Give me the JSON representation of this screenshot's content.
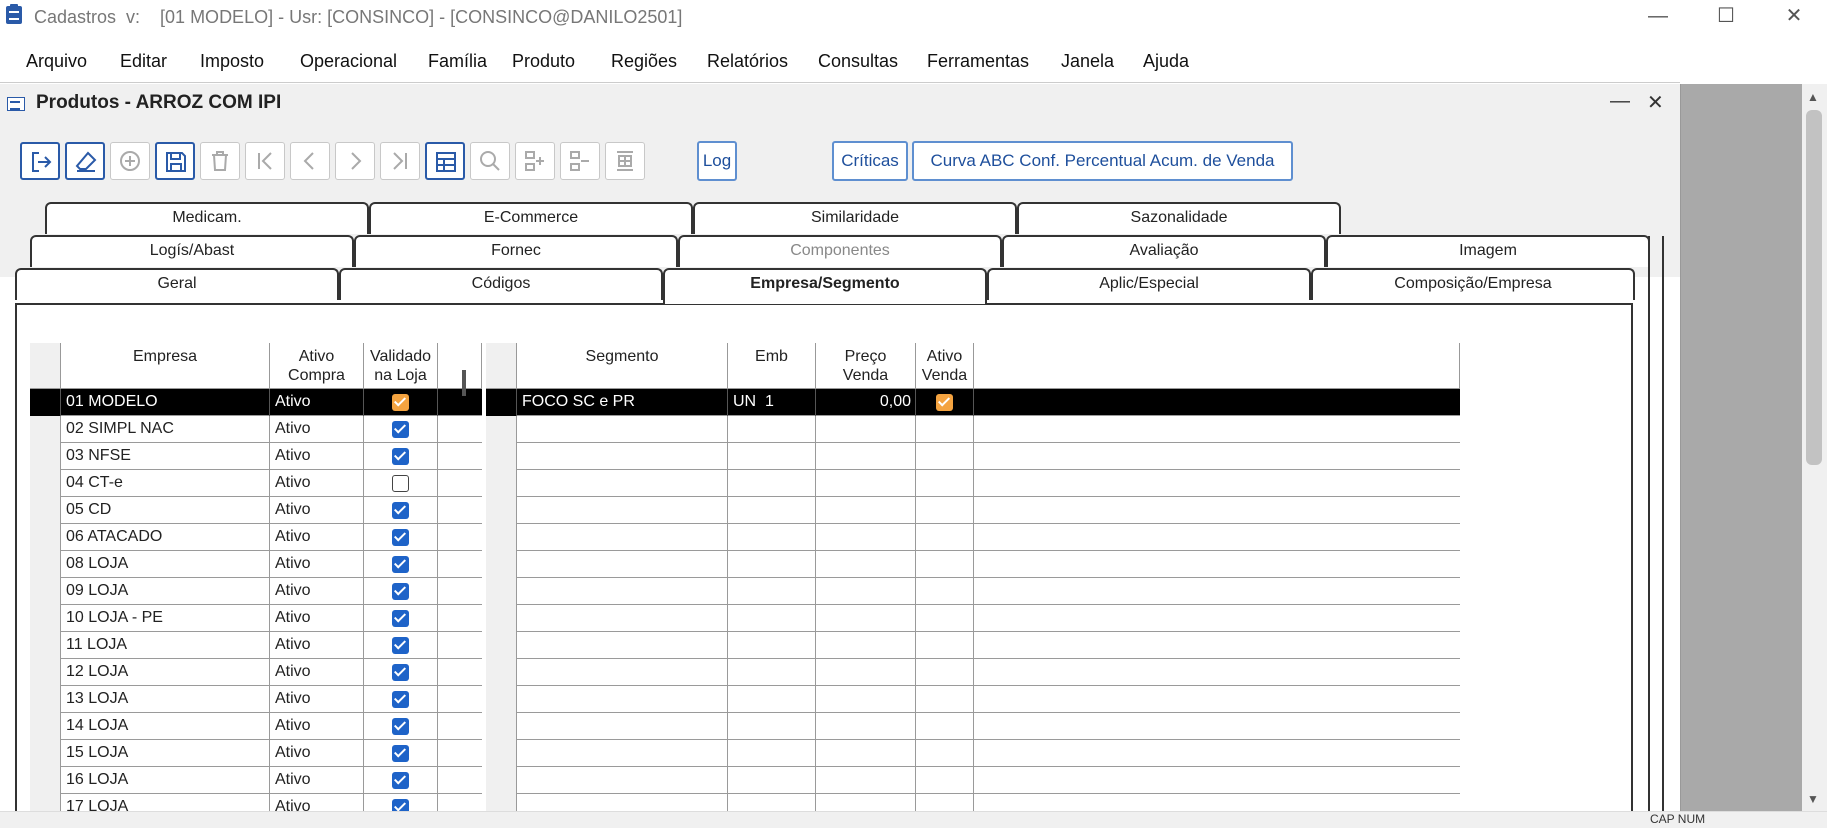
{
  "window": {
    "title": "Cadastros  v:    [01 MODELO] - Usr: [CONSINCO] - [CONSINCO@DANILO2501]",
    "minimize": "—",
    "maximize": "☐",
    "close": "✕"
  },
  "menu": [
    "Arquivo",
    "Editar",
    "Imposto",
    "Operacional",
    "Família",
    "Produto",
    "Regiões",
    "Relatórios",
    "Consultas",
    "Ferramentas",
    "Janela",
    "Ajuda"
  ],
  "inner": {
    "title": "Produtos - ARROZ COM IPI",
    "minimize": "—",
    "close": "✕"
  },
  "toolbar": {
    "icons": [
      "exit-icon",
      "eraser-icon",
      "add-icon",
      "save-icon",
      "delete-icon",
      "first-icon",
      "previous-icon",
      "next-icon",
      "last-icon",
      "grid-icon",
      "search-icon",
      "insert-row-icon",
      "remove-row-icon",
      "split-icon"
    ],
    "log_label": "Log",
    "criticas_label": "Críticas",
    "curva_label": "Curva ABC Conf. Percentual Acum. de Venda"
  },
  "tabs": {
    "row1": [
      "Medicam.",
      "E-Commerce",
      "Similaridade",
      "Sazonalidade"
    ],
    "row2": [
      "Logís/Abast",
      "Fornec",
      "Componentes",
      "Avaliação",
      "Imagem"
    ],
    "row3": [
      "Geral",
      "Códigos",
      "Empresa/Segmento",
      "Aplic/Especial",
      "Composição/Empresa"
    ],
    "selected": "Empresa/Segmento"
  },
  "empresa_grid": {
    "headers": [
      "Empresa",
      "Ativo Compra",
      "Validado na Loja"
    ],
    "header_lines": [
      [
        "Empresa"
      ],
      [
        "Ativo",
        "Compra"
      ],
      [
        "Validado",
        "na Loja"
      ]
    ],
    "rows": [
      {
        "empresa": "01 MODELO",
        "ativo": "Ativo",
        "validado": "selected"
      },
      {
        "empresa": "02 SIMPL NAC",
        "ativo": "Ativo",
        "validado": "on"
      },
      {
        "empresa": "03 NFSE",
        "ativo": "Ativo",
        "validado": "on"
      },
      {
        "empresa": "04 CT-e",
        "ativo": "Ativo",
        "validado": "off"
      },
      {
        "empresa": "05 CD",
        "ativo": "Ativo",
        "validado": "on"
      },
      {
        "empresa": "06 ATACADO",
        "ativo": "Ativo",
        "validado": "on"
      },
      {
        "empresa": "08 LOJA",
        "ativo": "Ativo",
        "validado": "on"
      },
      {
        "empresa": "09 LOJA",
        "ativo": "Ativo",
        "validado": "on"
      },
      {
        "empresa": "10 LOJA - PE",
        "ativo": "Ativo",
        "validado": "on"
      },
      {
        "empresa": "11 LOJA",
        "ativo": "Ativo",
        "validado": "on"
      },
      {
        "empresa": "12 LOJA",
        "ativo": "Ativo",
        "validado": "on"
      },
      {
        "empresa": "13 LOJA",
        "ativo": "Ativo",
        "validado": "on"
      },
      {
        "empresa": "14 LOJA",
        "ativo": "Ativo",
        "validado": "on"
      },
      {
        "empresa": "15 LOJA",
        "ativo": "Ativo",
        "validado": "on"
      },
      {
        "empresa": "16 LOJA",
        "ativo": "Ativo",
        "validado": "on"
      },
      {
        "empresa": "17 LOJA",
        "ativo": "Ativo",
        "validado": "on"
      }
    ]
  },
  "segmento_grid": {
    "header_lines": [
      [
        "Segmento"
      ],
      [
        "Emb"
      ],
      [
        "Preço",
        "Venda"
      ],
      [
        "Ativo",
        "Venda"
      ]
    ],
    "rows": [
      {
        "segmento": "FOCO SC e PR",
        "emb": "UN  1",
        "preco": "0,00",
        "ativo": "selected"
      }
    ],
    "empty_rows": 15
  },
  "statusbar": {
    "text": "CAP  NUM"
  },
  "colors": {
    "accent": "#1e63c8",
    "selected_check": "#f4a340",
    "side_gray": "#a9a9a9"
  }
}
